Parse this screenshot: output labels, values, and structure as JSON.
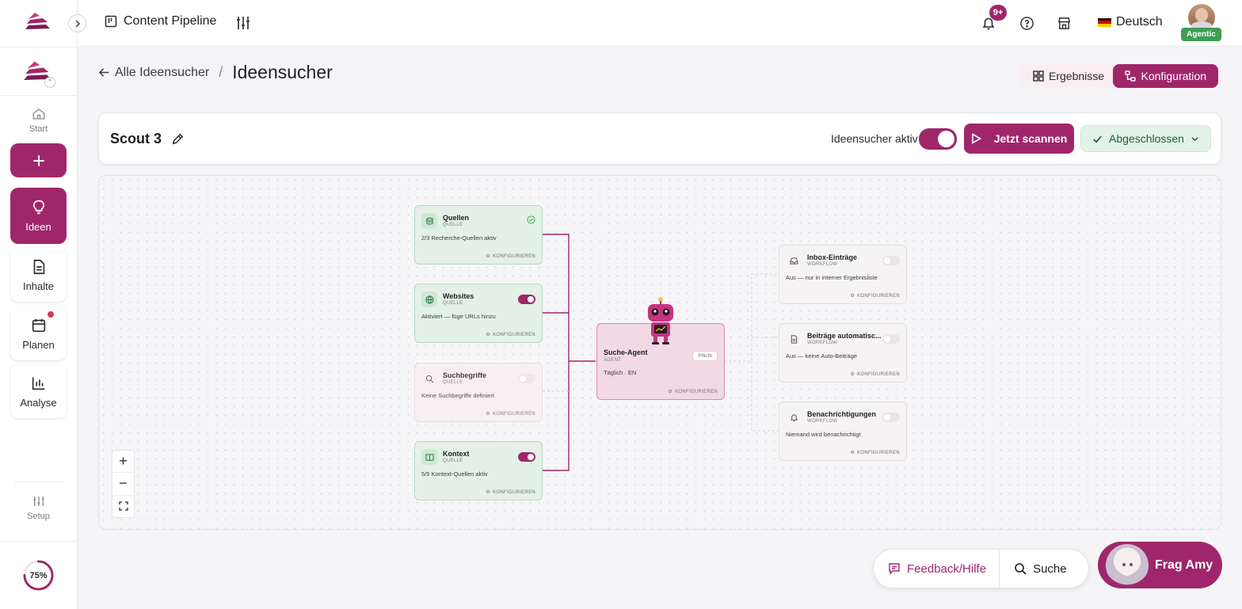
{
  "topbar": {
    "app_name": "Content Pipeline",
    "notifications_badge": "9+",
    "language": "Deutsch",
    "user_badge": "Agentic"
  },
  "sidebar": {
    "items": [
      {
        "label": "Start",
        "icon": "home-icon"
      },
      {
        "label": "Ideen",
        "icon": "lightbulb-icon",
        "active": true
      },
      {
        "label": "Inhalte",
        "icon": "document-icon"
      },
      {
        "label": "Planen",
        "icon": "calendar-icon",
        "has_dot": true
      },
      {
        "label": "Analyse",
        "icon": "bar-chart-icon"
      },
      {
        "label": "Setup",
        "icon": "sliders-icon"
      }
    ],
    "progress": "75%",
    "progress_value": 0.75
  },
  "header": {
    "back_label": "Alle Ideensucher",
    "separator": "/",
    "title": "Ideensucher",
    "tabs": [
      {
        "label": "Ergebnisse",
        "active": false
      },
      {
        "label": "Konfiguration",
        "active": true
      }
    ]
  },
  "scout": {
    "name": "Scout 3",
    "active_label": "Ideensucher aktiv",
    "active": true,
    "scan_label": "Jetzt scannen",
    "status_label": "Abgeschlossen"
  },
  "flow": {
    "sources": [
      {
        "title": "Quellen",
        "type": "QUELLE",
        "desc": "2/3 Recherche-Quellen aktiv",
        "control": "check",
        "configure": "KONFIGURIEREN"
      },
      {
        "title": "Websites",
        "type": "QUELLE",
        "desc": "Aktiviert — füge URLs hinzu",
        "control": "on",
        "configure": "KONFIGURIEREN"
      },
      {
        "title": "Suchbegriffe",
        "type": "QUELLE",
        "desc": "Keine Suchbegriffe definiert",
        "control": "off",
        "configure": "KONFIGURIEREN"
      },
      {
        "title": "Kontext",
        "type": "QUELLE",
        "desc": "5/5 Kontext-Quellen aktiv",
        "control": "on",
        "configure": "KONFIGURIEREN"
      }
    ],
    "agent": {
      "title": "Suche-Agent",
      "type": "AGENT",
      "desc": "Täglich · EN",
      "badge": "Pflicht",
      "configure": "KONFIGURIEREN"
    },
    "workflows": [
      {
        "title": "Inbox-Einträge",
        "type": "WORKFLOW",
        "desc": "Aus — nur in interner Ergebnisliste",
        "configure": "KONFIGURIEREN"
      },
      {
        "title": "Beiträge automatisc...",
        "type": "WORKFLOW",
        "desc": "Aus — keine Auto-Beiträge",
        "configure": "KONFIGURIEREN"
      },
      {
        "title": "Benachrichtigungen",
        "type": "WORKFLOW",
        "desc": "Niemand wird benachrichtigt",
        "configure": "KONFIGURIEREN"
      }
    ]
  },
  "footer": {
    "feedback_label": "Feedback/Hilfe",
    "search_label": "Suche",
    "amy_label": "Frag Amy"
  },
  "colors": {
    "brand": "#a0266c",
    "success": "#3e9d55"
  }
}
